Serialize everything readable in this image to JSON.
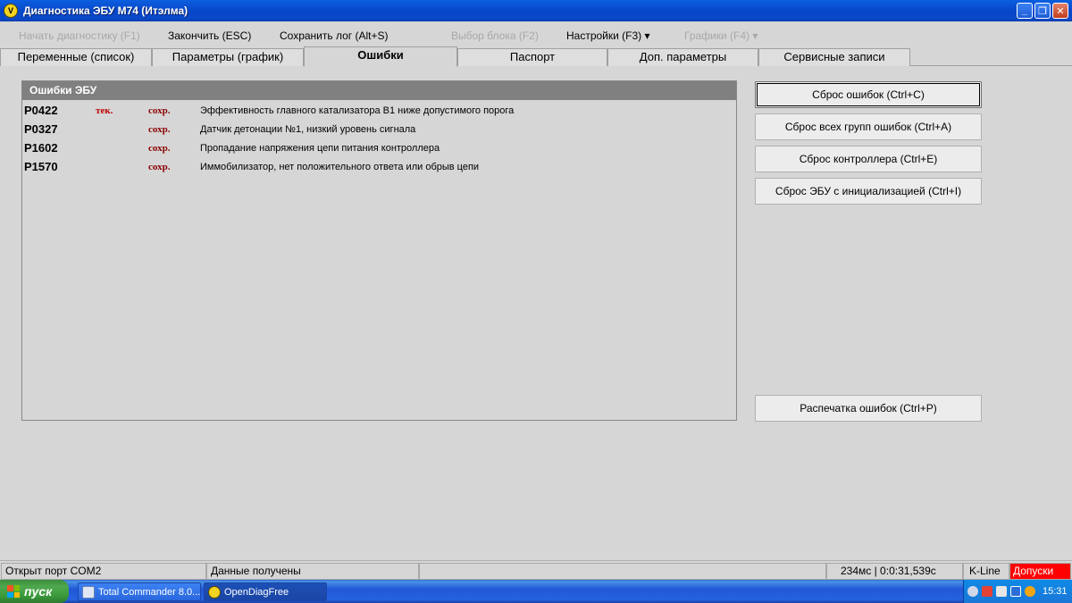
{
  "window": {
    "title": "Диагностика ЭБУ М74 (Итэлма)",
    "minimize": "_",
    "restore": "❐",
    "close": "✕"
  },
  "menu": {
    "start_diag": "Начать диагностику (F1)",
    "finish": "Закончить (ESC)",
    "save_log": "Сохранить лог (Alt+S)",
    "select_block": "Выбор блока (F2)",
    "settings": "Настройки (F3) ▾",
    "graphs": "Графики (F4) ▾"
  },
  "tabs": [
    {
      "label": "Переменные (список)"
    },
    {
      "label": "Параметры (график)"
    },
    {
      "label": "Ошибки"
    },
    {
      "label": "Паспорт"
    },
    {
      "label": "Доп. параметры"
    },
    {
      "label": "Сервисные записи"
    }
  ],
  "active_tab": "Ошибки",
  "errors_panel": {
    "title": "Ошибки ЭБУ",
    "rows": [
      {
        "code": "P0422",
        "current": "тек.",
        "saved": "сохр.",
        "description": "Эффективность главного катализатора В1 ниже допустимого порога"
      },
      {
        "code": "P0327",
        "current": "",
        "saved": "сохр.",
        "description": "Датчик детонации №1, низкий уровень сигнала"
      },
      {
        "code": "P1602",
        "current": "",
        "saved": "сохр.",
        "description": "Пропадание напряжения цепи питания контроллера"
      },
      {
        "code": "P1570",
        "current": "",
        "saved": "сохр.",
        "description": "Иммобилизатор, нет положительного ответа или обрыв цепи"
      }
    ]
  },
  "actions": {
    "reset_errors": "Сброс ошибок (Ctrl+C)",
    "reset_all_groups": "Сброс всех групп ошибок (Ctrl+A)",
    "reset_controller": "Сброс контроллера (Ctrl+E)",
    "reset_ecu_init": "Сброс ЭБУ с инициализацией (Ctrl+I)",
    "print_errors": "Распечатка ошибок (Ctrl+P)"
  },
  "status": {
    "port": "Открыт порт COM2",
    "data": "Данные получены",
    "empty": "",
    "timing": "234мс | 0:0:31,539с",
    "interface": "K-Line",
    "tolerances": "Допуски"
  },
  "taskbar": {
    "start": "пуск",
    "apps": [
      {
        "label": "Total Commander 8.0..."
      },
      {
        "label": "OpenDiagFree"
      }
    ],
    "clock": "15:31"
  },
  "colors": {
    "titlebar": "#0646c8",
    "error_current": "#c00000",
    "error_saved": "#8b0000",
    "tolerances_bg": "#ff0000",
    "panel_header": "#808080"
  }
}
